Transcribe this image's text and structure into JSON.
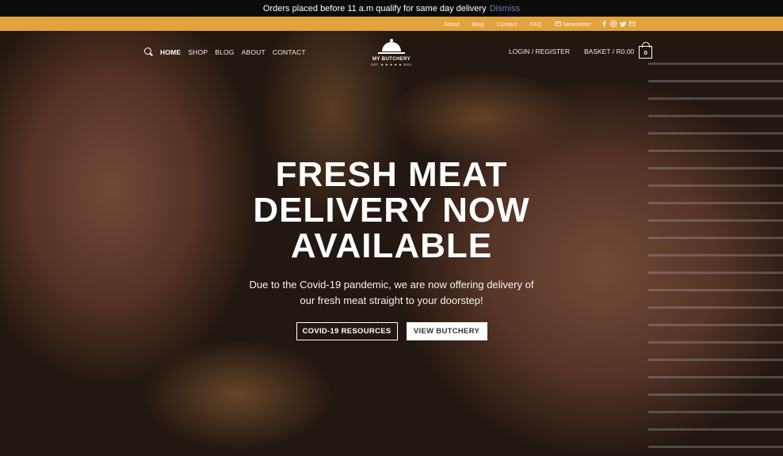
{
  "notice": {
    "text": "Orders placed before 11 a.m qualify for same day delivery",
    "dismiss": "Dismiss"
  },
  "topbar": {
    "links": [
      "About",
      "Blog",
      "Contact",
      "FAQ"
    ],
    "newsletter": "Newsletter",
    "social_icons": [
      "facebook-icon",
      "instagram-icon",
      "twitter-icon",
      "email-icon"
    ]
  },
  "nav": {
    "items": [
      "HOME",
      "SHOP",
      "BLOG",
      "ABOUT",
      "CONTACT"
    ],
    "active": "HOME",
    "logo_name": "MY BUTCHERY",
    "logo_est": "EST. ★ ★ ★ ★ ★ 2021",
    "login": "LOGIN / REGISTER",
    "basket": "BASKET / R0.00",
    "basket_count": "0"
  },
  "hero": {
    "headline_lines": [
      "FRESH MEAT",
      "DELIVERY NOW",
      "AVAILABLE"
    ],
    "subtext": "Due to the Covid-19 pandemic, we are now offering delivery of our fresh meat straight to your doorstep!",
    "button_primary": "COVID-19 RESOURCES",
    "button_secondary": "VIEW BUTCHERY"
  },
  "colors": {
    "topbar": "#e2a33d",
    "notice_bg": "#0b0b0b",
    "dismiss": "#6d7fb3"
  }
}
